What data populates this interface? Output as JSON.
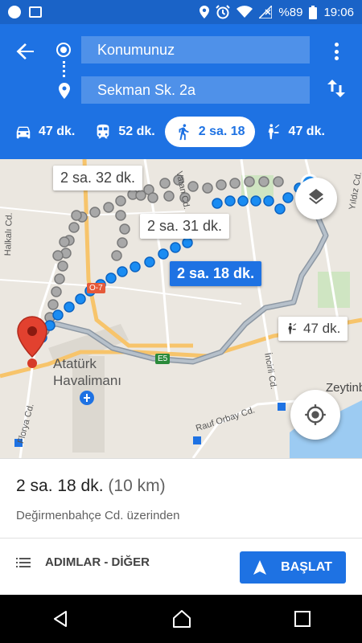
{
  "status_bar": {
    "battery": "%89",
    "time": "19:06"
  },
  "header": {
    "from": "Konumunuz",
    "to": "Sekman Sk. 2a"
  },
  "modes": [
    {
      "name": "car",
      "label": "47 dk."
    },
    {
      "name": "transit",
      "label": "52 dk."
    },
    {
      "name": "walk",
      "label": "2 sa. 18"
    },
    {
      "name": "ride",
      "label": "47 dk."
    }
  ],
  "map": {
    "route_labels": {
      "alt1": "2 sa. 32 dk.",
      "alt2": "2 sa. 31 dk.",
      "main": "2 sa. 18 dk.",
      "car": "47 dk."
    },
    "places": {
      "airport_line1": "Atatürk",
      "airport_line2": "Havalimanı",
      "zeytin": "Zeytinb",
      "halkali": "Halkalı Cd.",
      "florya": "Florya Cd.",
      "rauf": "Rauf Orbay Cd.",
      "incirli": "İncirli Cd.",
      "yildiz": "Yıldız Cd.",
      "vatan": "Vatan Cd.",
      "o7": "O-7",
      "e5": "E5"
    }
  },
  "summary": {
    "time": "2 sa. 18 dk.",
    "distance": "(10 km)",
    "via": "Değirmenbahçe Cd. üzerinden"
  },
  "actions": {
    "steps": "ADIMLAR - DİĞER",
    "start": "BAŞLAT"
  },
  "colors": {
    "primary": "#1e72e3",
    "status_bar": "#1a63c7",
    "route_main": "#1a8cf2",
    "route_alt": "#a8a8a8"
  }
}
